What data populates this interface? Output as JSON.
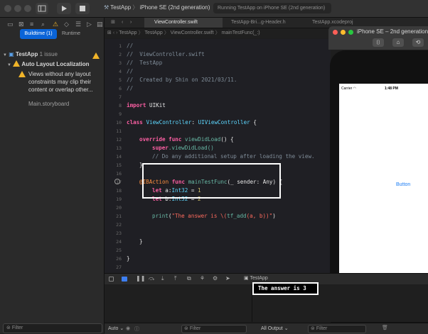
{
  "toolbar": {
    "scheme": "TestApp",
    "device": "iPhone SE (2nd generation)",
    "status": "Running TestApp on iPhone SE (2nd generation)"
  },
  "navigator": {
    "buildtime": "Buildtime (1)",
    "runtime": "Runtime",
    "project": "TestApp",
    "issue_count": "1 issue",
    "group": "Auto Layout Localization",
    "warning_lines": [
      "Views without any layout",
      "constraints may clip their",
      "content or overlap other..."
    ],
    "file": "Main.storyboard",
    "filter_placeholder": "Filter"
  },
  "tabs": [
    "ViewController.swift",
    "TestApp-Bri...g-Header.h",
    "TestApp.xcodeproj"
  ],
  "jumpbar": [
    "TestApp",
    "TestApp",
    "ViewController.swift",
    "mainTestFunc(_:)"
  ],
  "code": {
    "line_numbers": [
      "1",
      "2",
      "3",
      "4",
      "5",
      "6",
      "7",
      "8",
      "9",
      "10",
      "11",
      "12",
      "13",
      "14",
      "15",
      "16",
      "17",
      "18",
      "19",
      "20",
      "21",
      "22",
      "23",
      "24",
      "25",
      "26",
      "27"
    ],
    "header_lines": [
      "//",
      "//  ViewController.swift",
      "//  TestApp",
      "//",
      "//  Created by Shin on 2021/03/11.",
      "//"
    ],
    "import_kw": "import",
    "import_name": "UIKit",
    "class_kw": "class",
    "class_name": "ViewController",
    "superclass": "UIViewController",
    "override_kw": "override func",
    "viewdidload": "viewDidLoad",
    "super_kw": "super",
    "super_call": ".viewDidLoad()",
    "comment_setup": "// Do any additional setup after loading the view.",
    "ibaction": "@IBAction",
    "func_kw": "func",
    "func_name": "mainTestFunc",
    "func_params": "(_ sender: Any) {",
    "let_kw": "let",
    "a_decl": "a:",
    "b_decl": "b:",
    "int_type": "Int32",
    "val_a": "1",
    "val_b": "2",
    "print_fn": "print",
    "print_str": "\"The answer is \\(",
    "tf_add": "tf_add",
    "print_args": "(a, b))\""
  },
  "simulator": {
    "title": "iPhone SE – 2nd generation",
    "carrier": "Carrier",
    "time": "1:48 PM",
    "button_label": "Button"
  },
  "debug": {
    "target": "TestApp",
    "console_output": "The answer is 3",
    "auto": "Auto",
    "all_output": "All Output",
    "filter": "Filter"
  }
}
